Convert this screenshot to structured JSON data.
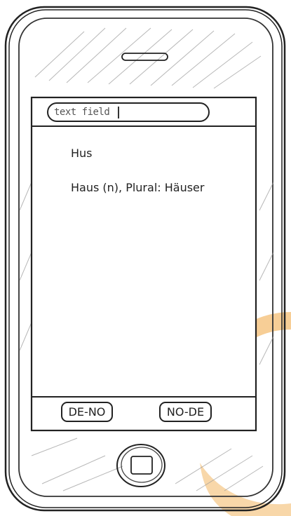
{
  "search": {
    "placeholder": "text field"
  },
  "result": {
    "source_word": "Hus",
    "translation": "Haus (n), Plural: Häuser"
  },
  "toolbar": {
    "de_no_label": "DE-NO",
    "no_de_label": "NO-DE"
  },
  "colors": {
    "stain": "#f0a640",
    "ink": "#222222"
  }
}
